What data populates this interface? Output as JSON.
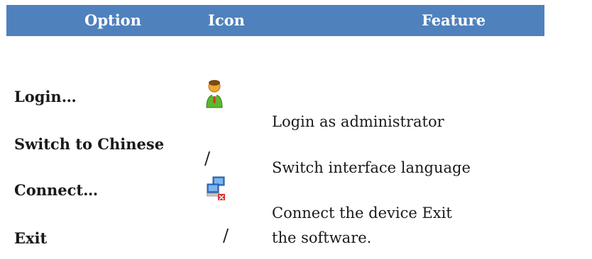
{
  "table": {
    "headers": {
      "option": "Option",
      "icon": "Icon",
      "feature": "Feature"
    },
    "rows": [
      {
        "option": "Login…",
        "icon": "user-icon",
        "feature": "Login as administrator"
      },
      {
        "option": "Switch to Chinese",
        "icon": "/",
        "feature": "Switch interface language"
      },
      {
        "option": "Connect…",
        "icon": "network-computers-icon",
        "feature": "Connect the device Exit"
      },
      {
        "option": "Exit",
        "icon": "/",
        "feature": "the software."
      }
    ]
  },
  "colors": {
    "header_bg": "#4f81bd",
    "header_text": "#ffffff"
  }
}
